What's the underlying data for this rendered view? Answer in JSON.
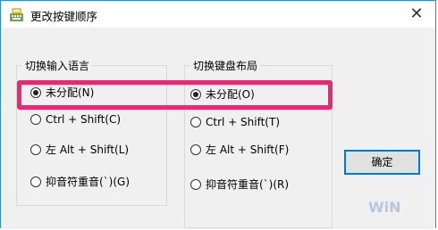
{
  "window": {
    "title": "更改按键顺序",
    "close_icon": "close-icon"
  },
  "groups": {
    "input_language": {
      "title": "切换输入语言",
      "options": [
        {
          "label": "未分配(N)",
          "checked": true
        },
        {
          "label": "Ctrl + Shift(C)",
          "checked": false
        },
        {
          "label": "左 Alt + Shift(L)",
          "checked": false
        },
        {
          "label": "抑音符重音(`)(G)",
          "checked": false
        }
      ]
    },
    "keyboard_layout": {
      "title": "切换键盘布局",
      "options": [
        {
          "label": "未分配(O)",
          "checked": true
        },
        {
          "label": "Ctrl + Shift(T)",
          "checked": false
        },
        {
          "label": "左 Alt + Shift(F)",
          "checked": false
        },
        {
          "label": "抑音符重音(`)(R)",
          "checked": false
        }
      ]
    }
  },
  "buttons": {
    "ok_label": "确定"
  },
  "colors": {
    "highlight": "#e82a70",
    "accent": "#0078d7"
  }
}
